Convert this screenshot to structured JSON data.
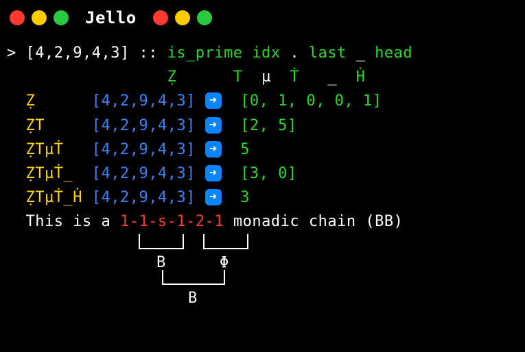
{
  "window": {
    "title": "Jello"
  },
  "prompt": {
    "marker": "> ",
    "input": "[4,2,9,4,3]",
    "sep": " :: ",
    "fn1": "is_prime",
    "fn2": "idx",
    "dot": " . ",
    "fn3": "last",
    "us": " _ ",
    "fn4": "head"
  },
  "header": {
    "z": "Ẓ",
    "t": "T",
    "mu": "µ",
    "tdot": "Ṫ",
    "us": "_",
    "hdot": "Ḣ"
  },
  "rows": [
    {
      "code": "Ẓ",
      "pad": "      ",
      "input": "[4,2,9,4,3]",
      "output": "[0, 1, 0, 0, 1]"
    },
    {
      "code": "ẒT",
      "pad": "     ",
      "input": "[4,2,9,4,3]",
      "output": "[2, 5]"
    },
    {
      "code": "ẒTµṪ",
      "pad": "   ",
      "input": "[4,2,9,4,3]",
      "output": "5"
    },
    {
      "code": "ẒTµṪ_",
      "pad": "  ",
      "input": "[4,2,9,4,3]",
      "output": "[3, 0]"
    },
    {
      "code": "ẒTµṪ_Ḣ",
      "pad": " ",
      "input": "[4,2,9,4,3]",
      "output": "3"
    }
  ],
  "footer": {
    "prefix": "  This is a ",
    "pattern": "1-1-s-1-2-1",
    "suffix": " monadic chain (BB)"
  },
  "brackets": {
    "b1": "B",
    "phi": "Φ",
    "b2": "B"
  }
}
